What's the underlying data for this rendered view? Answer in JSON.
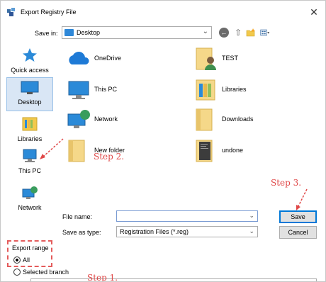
{
  "window": {
    "title": "Export Registry File"
  },
  "toolbar": {
    "save_in_label": "Save in:",
    "save_in_value": "Desktop"
  },
  "nav": {
    "items": [
      {
        "label": "Quick access",
        "icon": "star-icon"
      },
      {
        "label": "Desktop",
        "icon": "desktop-icon"
      },
      {
        "label": "Libraries",
        "icon": "libraries-icon"
      },
      {
        "label": "This PC",
        "icon": "computer-icon"
      },
      {
        "label": "Network",
        "icon": "network-icon"
      }
    ]
  },
  "files": [
    {
      "name": "OneDrive",
      "icon": "cloud-icon"
    },
    {
      "name": "TEST",
      "icon": "user-folder-icon"
    },
    {
      "name": "This PC",
      "icon": "computer-icon"
    },
    {
      "name": "Libraries",
      "icon": "libraries-icon"
    },
    {
      "name": "Network",
      "icon": "network-icon"
    },
    {
      "name": "Downloads",
      "icon": "folder-icon"
    },
    {
      "name": "New folder",
      "icon": "folder-icon"
    },
    {
      "name": "undone",
      "icon": "folder-icon"
    }
  ],
  "form": {
    "file_name_label": "File name:",
    "file_name_value": "",
    "save_type_label": "Save as type:",
    "save_type_value": "Registration Files (*.reg)"
  },
  "buttons": {
    "save": "Save",
    "cancel": "Cancel"
  },
  "export_range": {
    "title": "Export range",
    "all_label": "All",
    "selected_label": "Selected branch"
  },
  "annotations": {
    "step1": "Step 1.",
    "step2": "Step 2.",
    "step3": "Step 3."
  },
  "colors": {
    "annotation": "#e04848",
    "selection": "#d9e6f5",
    "accent": "#0078d7"
  }
}
